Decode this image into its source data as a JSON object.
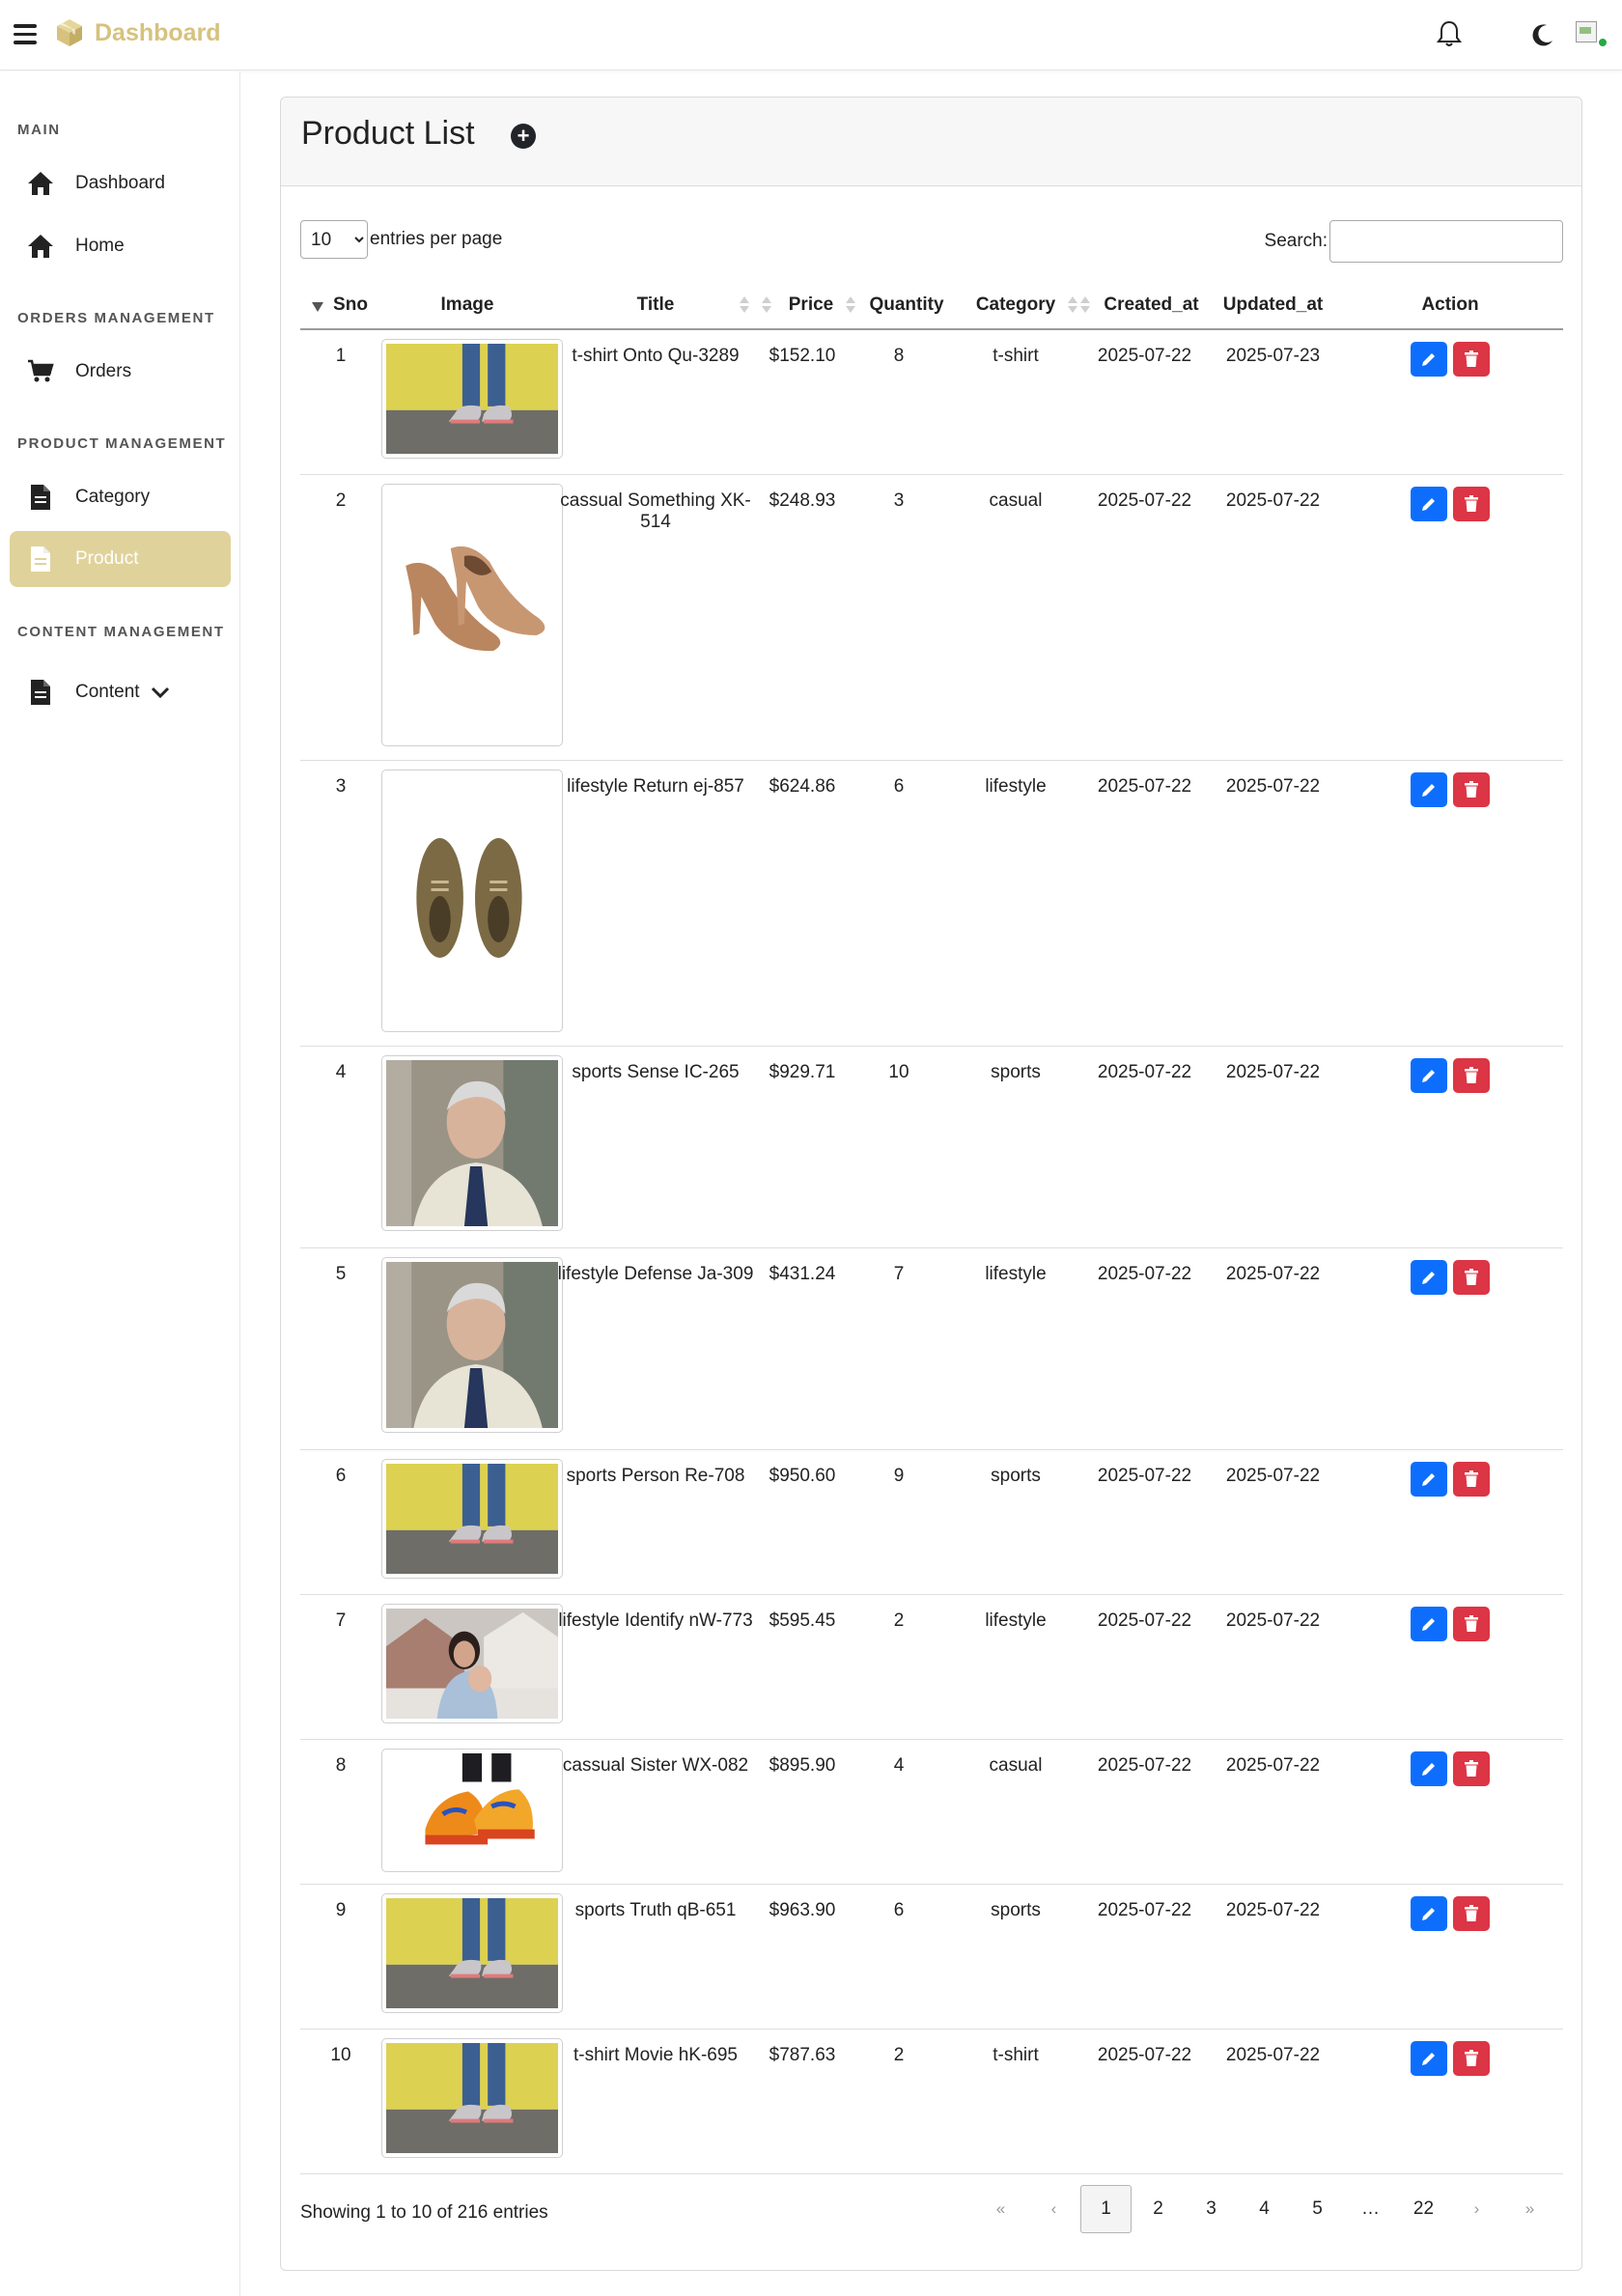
{
  "topbar": {
    "brand": "Dashboard",
    "accent": "#d6c27e"
  },
  "sidebar": {
    "sections": [
      {
        "title": "MAIN"
      },
      {
        "title": "ORDERS MANAGEMENT"
      },
      {
        "title": "PRODUCT MANAGEMENT"
      },
      {
        "title": "CONTENT MANAGEMENT"
      }
    ],
    "items": [
      {
        "label": "Dashboard",
        "icon": "home-icon"
      },
      {
        "label": "Home",
        "icon": "home-icon"
      },
      {
        "label": "Orders",
        "icon": "cart-icon"
      },
      {
        "label": "Category",
        "icon": "file-icon"
      },
      {
        "label": "Product",
        "icon": "file-icon",
        "active": true
      },
      {
        "label": "Content",
        "icon": "file-icon"
      }
    ],
    "active_color": "#e0d29b"
  },
  "card": {
    "title": "Product List",
    "per_page_value": "10",
    "per_page_label": "entries per page",
    "search_label": "Search:",
    "search_value": ""
  },
  "table": {
    "columns": [
      "Sno",
      "Image",
      "Title",
      "Price",
      "Quantity",
      "Category",
      "Created_at",
      "Updated_at",
      "Action"
    ],
    "rows": [
      {
        "sno": "1",
        "image": "sneakers-yellow-wall",
        "title": "t-shirt Onto Qu-3289",
        "price": "$152.10",
        "qty": "8",
        "category": "t-shirt",
        "created": "2025-07-22",
        "updated": "2025-07-23"
      },
      {
        "sno": "2",
        "image": "brown-heels",
        "title": "cassual Something XK-514",
        "price": "$248.93",
        "qty": "3",
        "category": "casual",
        "created": "2025-07-22",
        "updated": "2025-07-22"
      },
      {
        "sno": "3",
        "image": "brown-shoes-top",
        "title": "lifestyle Return ej-857",
        "price": "$624.86",
        "qty": "6",
        "category": "lifestyle",
        "created": "2025-07-22",
        "updated": "2025-07-22"
      },
      {
        "sno": "4",
        "image": "portrait-man",
        "title": "sports Sense IC-265",
        "price": "$929.71",
        "qty": "10",
        "category": "sports",
        "created": "2025-07-22",
        "updated": "2025-07-22"
      },
      {
        "sno": "5",
        "image": "portrait-man",
        "title": "lifestyle Defense Ja-309",
        "price": "$431.24",
        "qty": "7",
        "category": "lifestyle",
        "created": "2025-07-22",
        "updated": "2025-07-22"
      },
      {
        "sno": "6",
        "image": "sneakers-yellow-wall",
        "title": "sports Person Re-708",
        "price": "$950.60",
        "qty": "9",
        "category": "sports",
        "created": "2025-07-22",
        "updated": "2025-07-22"
      },
      {
        "sno": "7",
        "image": "mother-child-house",
        "title": "lifestyle Identify nW-773",
        "price": "$595.45",
        "qty": "2",
        "category": "lifestyle",
        "created": "2025-07-22",
        "updated": "2025-07-22"
      },
      {
        "sno": "8",
        "image": "orange-sneakers",
        "title": "cassual Sister WX-082",
        "price": "$895.90",
        "qty": "4",
        "category": "casual",
        "created": "2025-07-22",
        "updated": "2025-07-22"
      },
      {
        "sno": "9",
        "image": "sneakers-yellow-wall",
        "title": "sports Truth qB-651",
        "price": "$963.90",
        "qty": "6",
        "category": "sports",
        "created": "2025-07-22",
        "updated": "2025-07-22"
      },
      {
        "sno": "10",
        "image": "sneakers-yellow-wall",
        "title": "t-shirt Movie hK-695",
        "price": "$787.63",
        "qty": "2",
        "category": "t-shirt",
        "created": "2025-07-22",
        "updated": "2025-07-22"
      }
    ],
    "edit_color": "#0d6efd",
    "delete_color": "#dc3545"
  },
  "footer": {
    "info": "Showing 1 to 10 of 216 entries",
    "pages": [
      "«",
      "‹",
      "1",
      "2",
      "3",
      "4",
      "5",
      "…",
      "22",
      "›",
      "»"
    ],
    "active_page": "1"
  }
}
